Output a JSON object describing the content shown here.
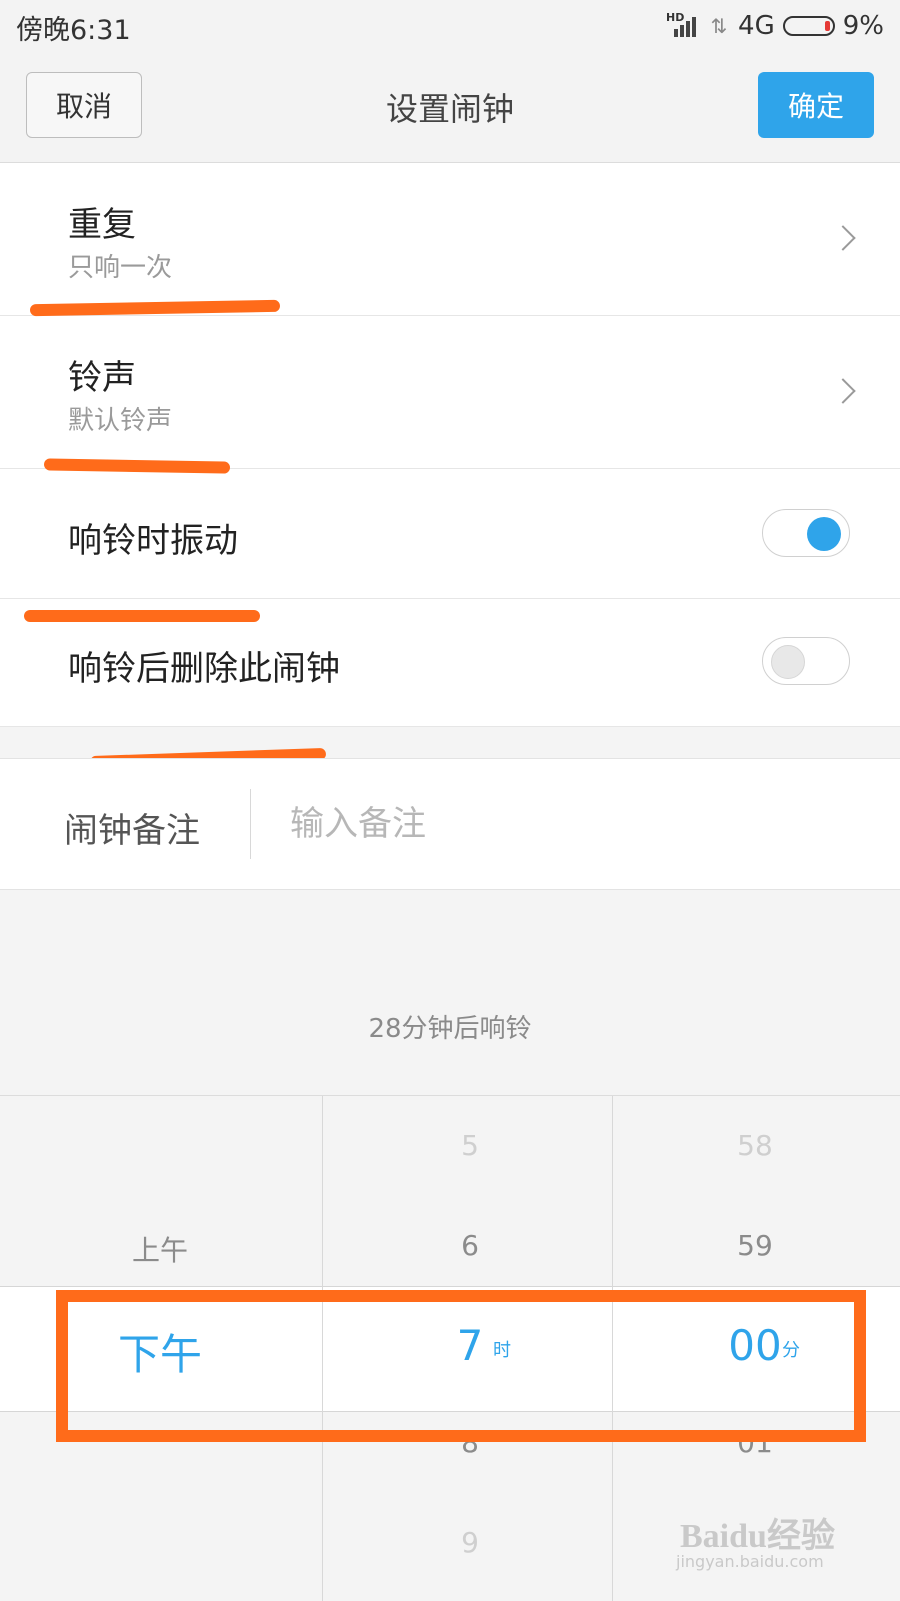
{
  "status_bar": {
    "time": "傍晚6:31",
    "network": "4G",
    "battery": "9%",
    "hd": "HD"
  },
  "title_bar": {
    "cancel": "取消",
    "title": "设置闹钟",
    "confirm": "确定"
  },
  "settings": {
    "repeat": {
      "label": "重复",
      "value": "只响一次"
    },
    "ringtone": {
      "label": "铃声",
      "value": "默认铃声"
    },
    "vibrate": {
      "label": "响铃时振动",
      "on": true
    },
    "delete_after": {
      "label": "响铃后删除此闹钟",
      "on": false
    }
  },
  "note": {
    "label": "闹钟备注",
    "placeholder": "输入备注"
  },
  "picker": {
    "hint": "28分钟后响铃",
    "ampm": [
      "上午",
      "下午"
    ],
    "ampm_selected": "下午",
    "hours": [
      "5",
      "6",
      "7",
      "8",
      "9"
    ],
    "hour_selected": "7",
    "hour_unit": "时",
    "minutes": [
      "58",
      "59",
      "00",
      "01"
    ],
    "minute_selected": "00",
    "minute_unit": "分"
  },
  "watermark": {
    "brand": "Baidu经验",
    "url": "jingyan.baidu.com"
  },
  "colors": {
    "accent": "#2fa4ea",
    "annotation": "#ff6b1a"
  }
}
